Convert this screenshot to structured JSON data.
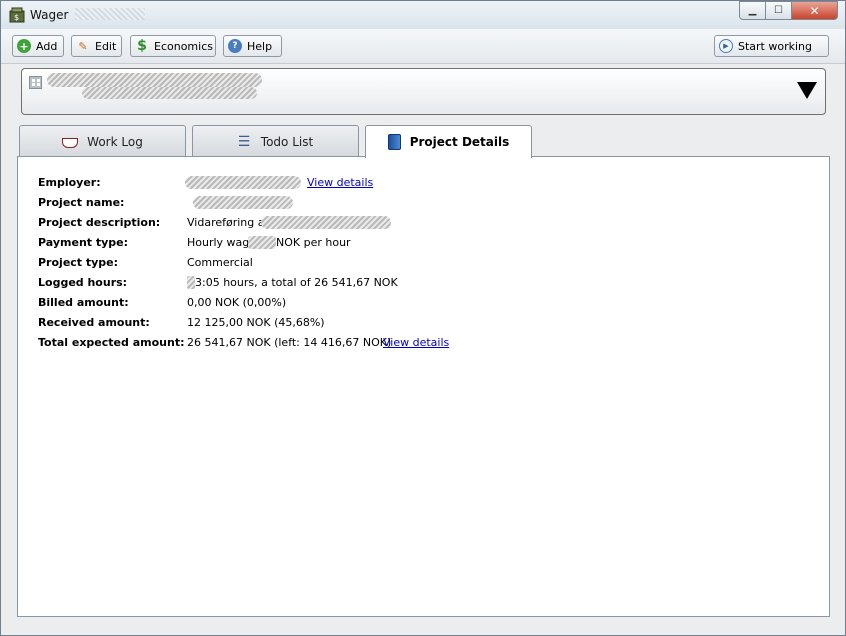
{
  "window": {
    "title": "Wager"
  },
  "toolbar": {
    "add_label": "Add",
    "edit_label": "Edit",
    "economics_label": "Economics",
    "help_label": "Help",
    "start_label": "Start working"
  },
  "tabs": [
    {
      "label": "Work Log",
      "icon": "cup-icon"
    },
    {
      "label": "Todo List",
      "icon": "list-icon"
    },
    {
      "label": "Project Details",
      "icon": "book-icon",
      "active": true
    }
  ],
  "details": {
    "employer_label": "Employer:",
    "employer_link": "View details",
    "project_name_label": "Project name:",
    "project_description_label": "Project description:",
    "project_description_value": "Vidareføring av",
    "payment_type_label": "Payment type:",
    "payment_type_prefix": "Hourly wage,",
    "payment_type_suffix": "NOK per hour",
    "project_type_label": "Project type:",
    "project_type_value": "Commercial",
    "logged_hours_label": "Logged hours:",
    "logged_hours_value": "3:05 hours, a total of 26 541,67 NOK",
    "billed_amount_label": "Billed amount:",
    "billed_amount_value": "0,00 NOK (0,00%)",
    "received_amount_label": "Received amount:",
    "received_amount_value": "12 125,00 NOK (45,68%)",
    "total_expected_label": "Total expected amount:",
    "total_expected_value": "26 541,67 NOK (left: 14 416,67 NOK)",
    "total_expected_link": "View details"
  },
  "colors": {
    "link": "#0000cc",
    "close_button": "#c8432c"
  }
}
